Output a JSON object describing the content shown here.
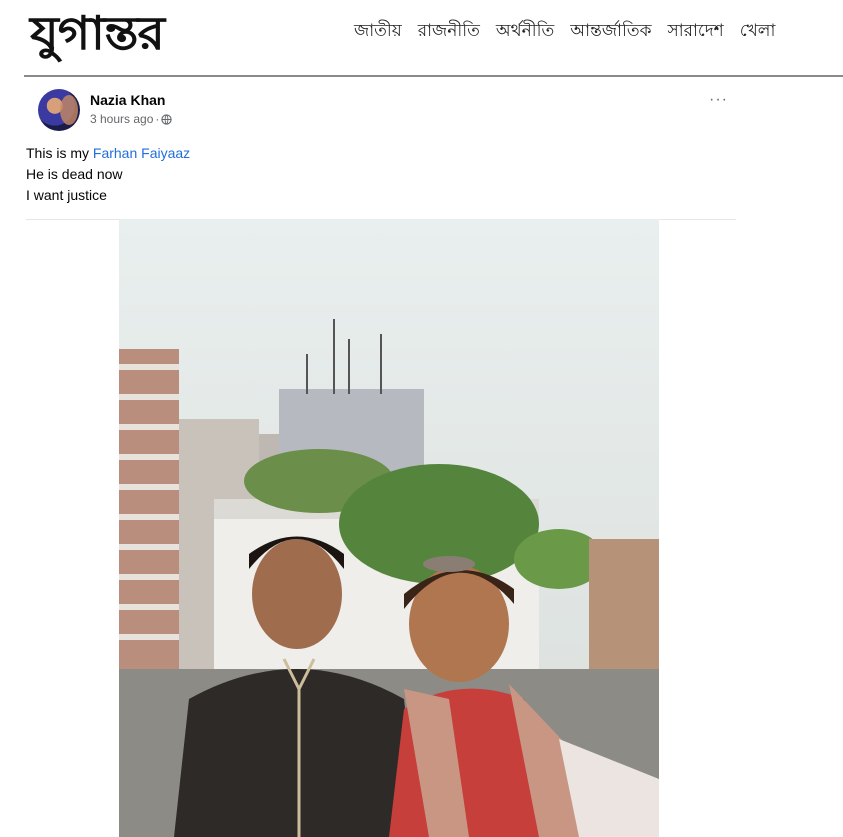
{
  "site": {
    "logo_text": "যুগান্তর",
    "nav": [
      "জাতীয়",
      "রাজনীতি",
      "অর্থনীতি",
      "আন্তর্জাতিক",
      "সারাদেশ",
      "খেলা"
    ]
  },
  "post": {
    "author": "Nazia Khan",
    "time": "3 hours ago",
    "separator": "·",
    "more_label": "···",
    "line1_prefix": "This is my ",
    "mention": "Farhan Faiyaaz",
    "line2": "He is dead now",
    "line3": "I want justice"
  },
  "photo": {
    "subject": "two people smiling on a rooftop with buildings and antennas behind"
  },
  "colors": {
    "mention": "#216fdb",
    "meta": "#65676b",
    "rule": "#8a8a8a"
  }
}
